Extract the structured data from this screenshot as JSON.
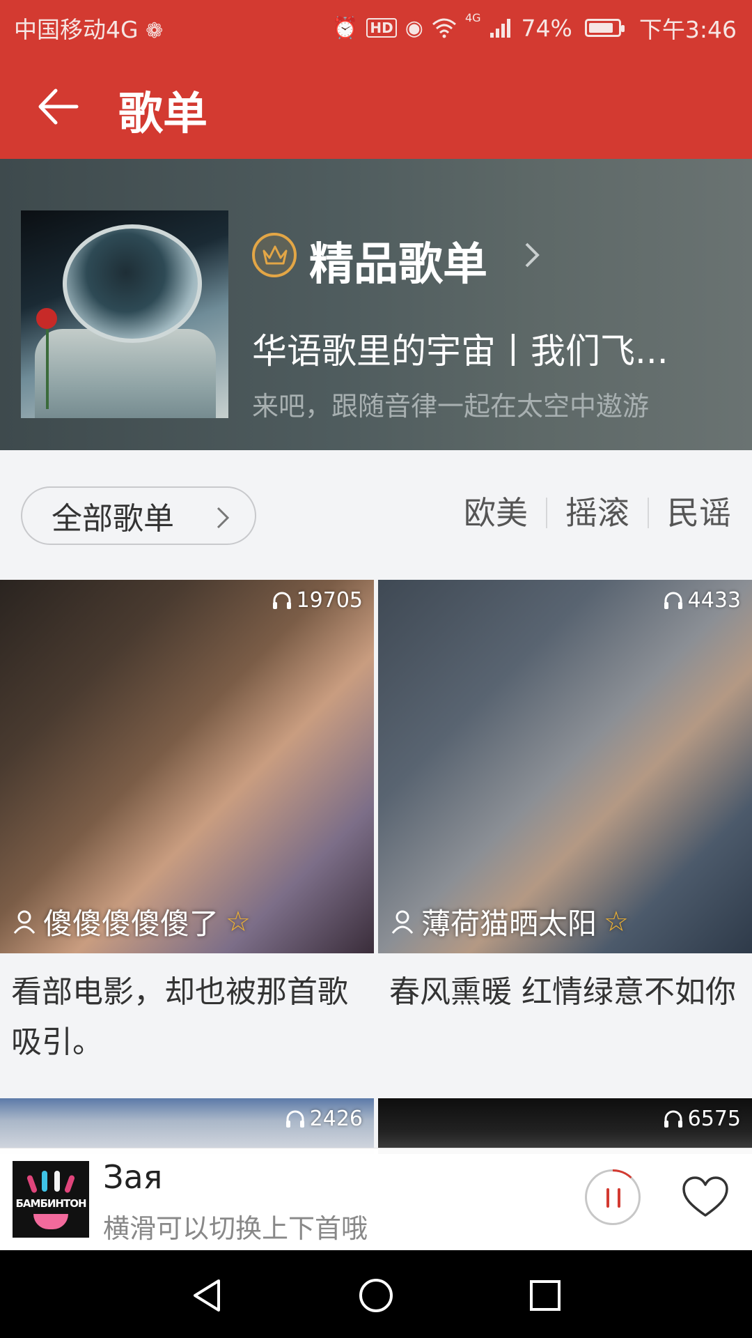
{
  "status_bar": {
    "carrier": "中国移动4G",
    "battery_percent": "74%",
    "battery_level": 0.74,
    "time": "下午3:46",
    "hd_label": "HD",
    "network_label": "4G",
    "icons": [
      "hotspot-icon",
      "alarm-icon",
      "hd-icon",
      "eye-care-icon",
      "wifi-icon",
      "signal-icon",
      "battery-icon"
    ]
  },
  "app_bar": {
    "title": "歌单",
    "back_icon": "arrow-left-icon"
  },
  "banner": {
    "tag": "精品歌单",
    "title": "华语歌里的宇宙丨我们飞...",
    "subtitle": "来吧，跟随音律一起在太空中遨游",
    "badge_icon": "crown-icon",
    "accent_color": "#e3a646"
  },
  "filters": {
    "all_button": "全部歌单",
    "tags": [
      "欧美",
      "摇滚",
      "民谣"
    ]
  },
  "playlists": [
    {
      "plays": "19705",
      "creator": "傻傻傻傻傻了",
      "title": "看部电影，却也被那首歌吸引。"
    },
    {
      "plays": "4433",
      "creator": "薄荷猫晒太阳",
      "title": "春风熏暖 红情绿意不如你"
    },
    {
      "plays": "2426"
    },
    {
      "plays": "6575"
    }
  ],
  "player": {
    "song": "Зая",
    "hint": "横滑可以切换上下首哦",
    "art_text": "БАМБИНТОН",
    "progress": 0.12
  },
  "colors": {
    "brand_red": "#d33a31",
    "star_color": "#f2b431"
  }
}
